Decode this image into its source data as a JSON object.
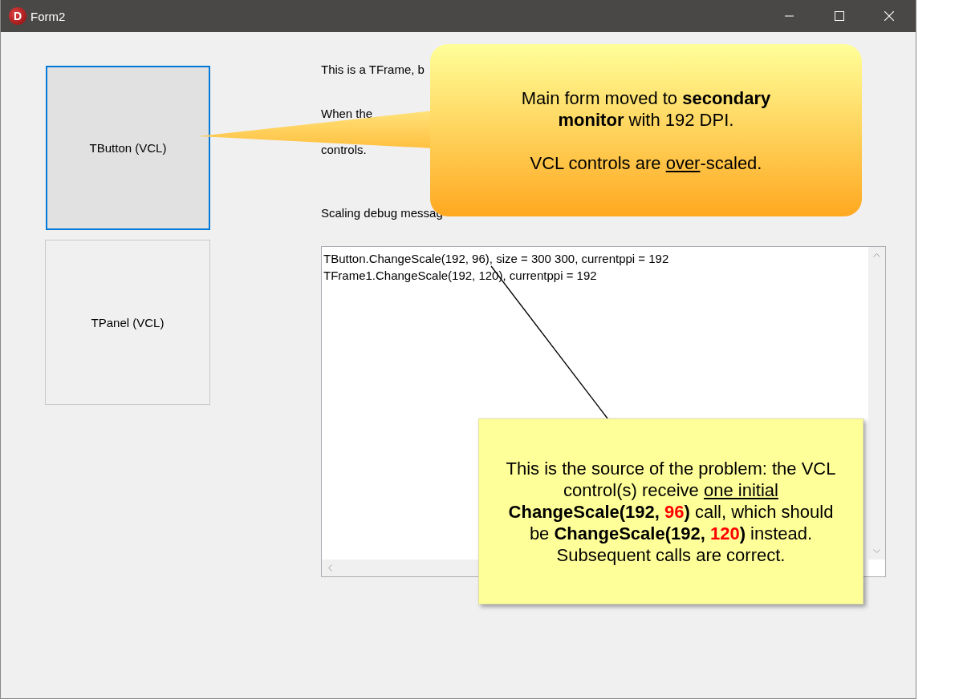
{
  "window": {
    "title": "Form2",
    "icon_letter": "D"
  },
  "vcl_button": {
    "label": "TButton (VCL)",
    "focused": true
  },
  "vcl_panel": {
    "label": "TPanel (VCL)"
  },
  "frame_texts": [
    "This is a TFrame, b",
    "When the",
    "controls.",
    "Scaling debug messag"
  ],
  "memo_lines": [
    "TButton.ChangeScale(192, 96), size = 300 300, currentppi = 192",
    "TFrame1.ChangeScale(192, 120), currentppi = 192"
  ],
  "callouts": [
    {
      "kind": "rounded",
      "paragraphs": [
        [
          [
            {
              "text": "Main form moved to ",
              "kind": "plain"
            },
            {
              "text": "secondary",
              "kind": "bold"
            }
          ],
          [
            {
              "text": "monitor",
              "kind": "bold"
            },
            {
              "text": " with 192 DPI.",
              "kind": "plain"
            }
          ]
        ],
        [
          [
            {
              "text": "VCL controls are ",
              "kind": "plain"
            },
            {
              "text": "over",
              "kind": "underline"
            },
            {
              "text": "-scaled.",
              "kind": "plain"
            }
          ]
        ]
      ]
    },
    {
      "kind": "rect",
      "paragraphs": [
        [
          [
            {
              "text": "This is the source of the problem: the VCL",
              "kind": "plain"
            }
          ],
          [
            {
              "text": "control(s) receive ",
              "kind": "plain"
            },
            {
              "text": "one initial",
              "kind": "underline"
            }
          ],
          [
            {
              "text": "ChangeScale(192, ",
              "kind": "bold"
            },
            {
              "text": "96",
              "kind": "alert"
            },
            {
              "text": ")",
              "kind": "bold"
            },
            {
              "text": " call, which should",
              "kind": "plain"
            }
          ],
          [
            {
              "text": "be ",
              "kind": "plain"
            },
            {
              "text": "ChangeScale(192, ",
              "kind": "bold"
            },
            {
              "text": "120",
              "kind": "alert"
            },
            {
              "text": ")",
              "kind": "bold"
            },
            {
              "text": " instead.",
              "kind": "plain"
            }
          ],
          [
            {
              "text": "Subsequent calls are correct.",
              "kind": "plain"
            }
          ]
        ]
      ]
    }
  ]
}
